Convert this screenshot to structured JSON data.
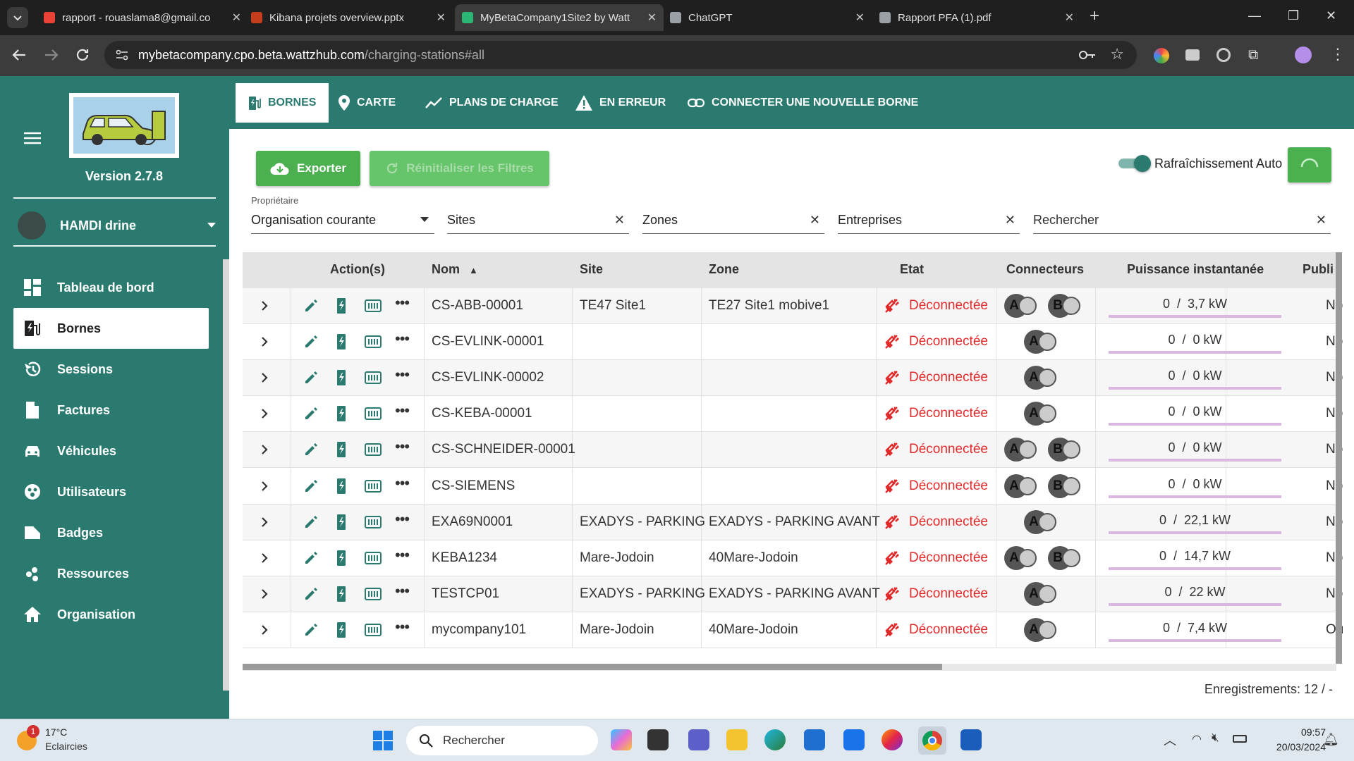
{
  "browser": {
    "tabs": [
      {
        "title": "rapport - rouaslama8@gmail.co",
        "icon": "gmail-icon",
        "color": "#ea4335"
      },
      {
        "title": "Kibana projets overview.pptx",
        "icon": "powerpoint-icon",
        "color": "#c43e1c"
      },
      {
        "title": "MyBetaCompany1Site2 by Watt",
        "icon": "wattzhub-icon",
        "color": "#2bb673"
      },
      {
        "title": "ChatGPT",
        "icon": "chatgpt-icon",
        "color": "#9aa0a6"
      },
      {
        "title": "Rapport PFA (1).pdf",
        "icon": "pdf-icon",
        "color": "#9aa0a6"
      }
    ],
    "url_host": "mybetacompany.cpo.beta.wattzhub.com",
    "url_path": "/charging-stations#all"
  },
  "sidebar": {
    "version": "Version 2.7.8",
    "user": "HAMDI drine",
    "items": [
      {
        "label": "Tableau de bord",
        "icon": "dashboard-icon"
      },
      {
        "label": "Bornes",
        "icon": "charging-station-icon"
      },
      {
        "label": "Sessions",
        "icon": "history-icon"
      },
      {
        "label": "Factures",
        "icon": "invoice-icon"
      },
      {
        "label": "Véhicules",
        "icon": "car-icon"
      },
      {
        "label": "Utilisateurs",
        "icon": "users-icon"
      },
      {
        "label": "Badges",
        "icon": "badge-icon"
      },
      {
        "label": "Ressources",
        "icon": "resources-icon"
      },
      {
        "label": "Organisation",
        "icon": "home-icon"
      }
    ]
  },
  "topmenu": {
    "items": [
      {
        "label": "BORNES",
        "icon": "charging-station-icon"
      },
      {
        "label": "CARTE",
        "icon": "map-pin-icon"
      },
      {
        "label": "PLANS DE CHARGE",
        "icon": "chart-line-icon"
      },
      {
        "label": "EN ERREUR",
        "icon": "warning-icon"
      },
      {
        "label": "CONNECTER UNE NOUVELLE BORNE",
        "icon": "link-icon"
      }
    ]
  },
  "toolbar": {
    "export_label": "Exporter",
    "reset_label": "Réinitialiser les Filtres",
    "auto_refresh_label": "Rafraîchissement Auto"
  },
  "filters": {
    "owner_label": "Propriétaire",
    "owner_value": "Organisation courante",
    "sites": "Sites",
    "zones": "Zones",
    "companies": "Entreprises",
    "search": "Rechercher"
  },
  "table": {
    "headers": {
      "actions": "Action(s)",
      "name": "Nom",
      "site": "Site",
      "zone": "Zone",
      "state": "Etat",
      "connectors": "Connecteurs",
      "power": "Puissance instantanée",
      "public": "Publi"
    },
    "rows": [
      {
        "name": "CS-ABB-00001",
        "site": "TE47 Site1",
        "zone": "TE27 Site1 mobive1",
        "state": "Déconnectée",
        "connectors": [
          "A",
          "B"
        ],
        "power": "0  /  3,7 kW",
        "public": "No"
      },
      {
        "name": "CS-EVLINK-00001",
        "site": "",
        "zone": "",
        "state": "Déconnectée",
        "connectors": [
          "A"
        ],
        "power": "0  /  0 kW",
        "public": "No"
      },
      {
        "name": "CS-EVLINK-00002",
        "site": "",
        "zone": "",
        "state": "Déconnectée",
        "connectors": [
          "A"
        ],
        "power": "0  /  0 kW",
        "public": "No"
      },
      {
        "name": "CS-KEBA-00001",
        "site": "",
        "zone": "",
        "state": "Déconnectée",
        "connectors": [
          "A"
        ],
        "power": "0  /  0 kW",
        "public": "No"
      },
      {
        "name": "CS-SCHNEIDER-00001",
        "site": "",
        "zone": "",
        "state": "Déconnectée",
        "connectors": [
          "A",
          "B"
        ],
        "power": "0  /  0 kW",
        "public": "No"
      },
      {
        "name": "CS-SIEMENS",
        "site": "",
        "zone": "",
        "state": "Déconnectée",
        "connectors": [
          "A",
          "B"
        ],
        "power": "0  /  0 kW",
        "public": "No"
      },
      {
        "name": "EXA69N0001",
        "site": "EXADYS - PARKING",
        "zone": "EXADYS - PARKING AVANT",
        "state": "Déconnectée",
        "connectors": [
          "A"
        ],
        "power": "0  /  22,1 kW",
        "public": "No"
      },
      {
        "name": "KEBA1234",
        "site": "Mare-Jodoin",
        "zone": "40Mare-Jodoin",
        "state": "Déconnectée",
        "connectors": [
          "A",
          "B"
        ],
        "power": "0  /  14,7 kW",
        "public": "No"
      },
      {
        "name": "TESTCP01",
        "site": "EXADYS - PARKING",
        "zone": "EXADYS - PARKING AVANT",
        "state": "Déconnectée",
        "connectors": [
          "A"
        ],
        "power": "0  /  22 kW",
        "public": "No"
      },
      {
        "name": "mycompany101",
        "site": "Mare-Jodoin",
        "zone": "40Mare-Jodoin",
        "state": "Déconnectée",
        "connectors": [
          "A"
        ],
        "power": "0  /  7,4 kW",
        "public": "Ou"
      }
    ],
    "records": "Enregistrements: 12 / -"
  },
  "taskbar": {
    "weather_temp": "17°C",
    "weather_desc": "Eclaircies",
    "weather_badge": "1",
    "search": "Rechercher",
    "time": "09:57",
    "date": "20/03/2024"
  },
  "colors": {
    "primary": "#2b7a70",
    "green_button": "#4caf50",
    "error": "#e02a2a"
  }
}
